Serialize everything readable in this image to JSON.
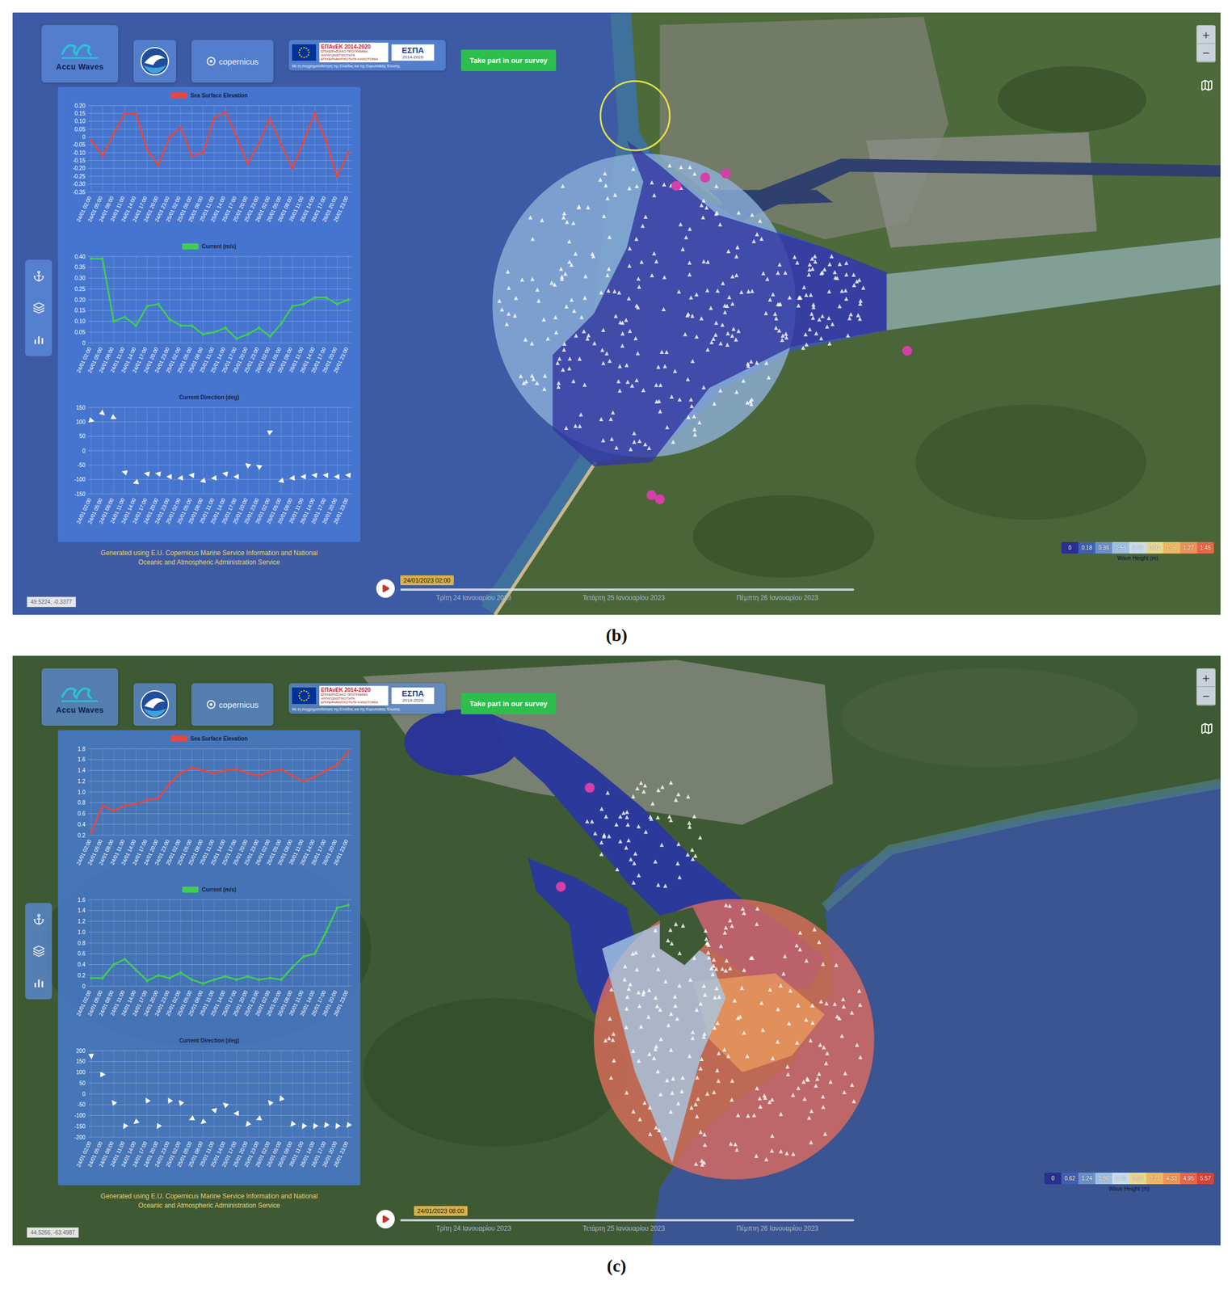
{
  "figures": [
    {
      "caption": "(b)",
      "kind": "estuary",
      "logos": {
        "app_name": "Accu Waves",
        "partner": "copernicus",
        "eu": {
          "epanek_title": "ΕΠΑνΕΚ 2014-2020",
          "epanek_subtitle": "ΕΠΙΧΕΙΡΗΣΙΑΚΟ ΠΡΟΓΡΑΜΜΑ ΑΝΤΑΓΩΝΙΣΤΙΚΟΤΗΤΑ ΕΠΙΧΕΙΡΗΜΑΤΙΚΟΤΗΤΑ ΚΑΙΝΟΤΟΜΙΑ",
          "espa_title": "ΕΣΠΑ",
          "espa_years": "2014-2020",
          "cofunding": "Με τη συγχρηματοδότηση της Ελλάδας και της Ευρωπαϊκής Ένωσης"
        }
      },
      "survey_button": "Take part in our survey",
      "zoom": [
        "+",
        "−"
      ],
      "charts": [
        {
          "title": "Sea Surface Elevation",
          "kind": "line",
          "color": "#e8473d",
          "y_ticks": [
            "0.20",
            "0.15",
            "0.10",
            "0.05",
            "0",
            "-0.05",
            "-0.10",
            "-0.15",
            "-0.20",
            "-0.25",
            "-0.30",
            "-0.35"
          ],
          "x_labels": [
            "24/01 02:00",
            "24/01 05:00",
            "24/01 08:00",
            "24/01 11:00",
            "24/01 14:00",
            "24/01 17:00",
            "24/01 20:00",
            "24/01 23:00",
            "25/01 02:00",
            "25/01 05:00",
            "25/01 08:00",
            "25/01 11:00",
            "25/01 14:00",
            "25/01 17:00",
            "25/01 20:00",
            "25/01 23:00",
            "26/01 02:00",
            "26/01 05:00",
            "26/01 08:00",
            "26/01 11:00",
            "26/01 14:00",
            "26/01 17:00",
            "26/01 20:00",
            "26/01 23:00"
          ],
          "values": [
            -0.02,
            -0.12,
            0.02,
            0.15,
            0.15,
            -0.08,
            -0.18,
            0.0,
            0.06,
            -0.12,
            -0.1,
            0.12,
            0.16,
            0.0,
            -0.17,
            -0.04,
            0.12,
            -0.05,
            -0.2,
            -0.03,
            0.15,
            -0.02,
            -0.25,
            -0.1
          ]
        },
        {
          "title": "Current (m/s)",
          "kind": "line",
          "color": "#3fcf4f",
          "y_ticks": [
            "0.40",
            "0.35",
            "0.30",
            "0.25",
            "0.20",
            "0.15",
            "0.10",
            "0.05",
            "0"
          ],
          "x_labels": [
            "24/01 02:00",
            "24/01 05:00",
            "24/01 08:00",
            "24/01 11:00",
            "24/01 14:00",
            "24/01 17:00",
            "24/01 20:00",
            "24/01 23:00",
            "25/01 02:00",
            "25/01 05:00",
            "25/01 08:00",
            "25/01 11:00",
            "25/01 14:00",
            "25/01 17:00",
            "25/01 20:00",
            "25/01 23:00",
            "26/01 02:00",
            "26/01 05:00",
            "26/01 08:00",
            "26/01 11:00",
            "26/01 14:00",
            "26/01 17:00",
            "26/01 20:00",
            "26/01 23:00"
          ],
          "values": [
            0.39,
            0.39,
            0.1,
            0.12,
            0.08,
            0.17,
            0.18,
            0.11,
            0.08,
            0.08,
            0.04,
            0.05,
            0.07,
            0.02,
            0.04,
            0.07,
            0.03,
            0.09,
            0.17,
            0.18,
            0.21,
            0.21,
            0.18,
            0.2
          ]
        },
        {
          "title": "Current Direction (deg)",
          "kind": "arrows",
          "color": "#ffffff",
          "y_ticks": [
            "150",
            "100",
            "50",
            "0",
            "-50",
            "-100",
            "-150"
          ],
          "x_labels": [
            "24/01 02:00",
            "24/01 05:00",
            "24/01 08:00",
            "24/01 11:00",
            "24/01 14:00",
            "24/01 17:00",
            "24/01 20:00",
            "24/01 23:00",
            "25/01 02:00",
            "25/01 05:00",
            "25/01 08:00",
            "25/01 11:00",
            "25/01 14:00",
            "25/01 17:00",
            "25/01 20:00",
            "25/01 23:00",
            "26/01 02:00",
            "26/01 05:00",
            "26/01 08:00",
            "26/01 11:00",
            "26/01 14:00",
            "26/01 17:00",
            "26/01 20:00",
            "26/01 23:00"
          ],
          "values": [
            105,
            130,
            115,
            -75,
            -110,
            -80,
            -80,
            -90,
            -95,
            -85,
            -105,
            -95,
            -80,
            -90,
            -50,
            -55,
            65,
            -105,
            -95,
            -90,
            -85,
            -85,
            -90,
            -85
          ]
        }
      ],
      "footnote": "Generated using E.U. Copernicus Marine Service Information and National Oceanic and Atmospheric Administration Service",
      "legend": {
        "title": "Wave Height (m)",
        "stops": [
          {
            "label": "0",
            "color": "#2b2f8f"
          },
          {
            "label": "0.18",
            "color": "#3f5fb0"
          },
          {
            "label": "0.36",
            "color": "#6b8fca"
          },
          {
            "label": "0.55",
            "color": "#9ec0e3"
          },
          {
            "label": "0.73",
            "color": "#c8dcea"
          },
          {
            "label": "0.91",
            "color": "#e8d890"
          },
          {
            "label": "1.09",
            "color": "#f0b860"
          },
          {
            "label": "1.27",
            "color": "#ee9455"
          },
          {
            "label": "1.45",
            "color": "#e8674a"
          }
        ]
      },
      "timeline": {
        "current": "24/01/2023 02:00",
        "level": 0.0,
        "days": [
          "Τρίτη 24 Ιανουαρίου 2023",
          "Τετάρτη 25 Ιανουαρίου 2023",
          "Πέμπτη 26 Ιανουαρίου 2023"
        ]
      },
      "coordinates": "49.5224, -0.3377"
    },
    {
      "caption": "(c)",
      "kind": "bay",
      "logos": {
        "app_name": "Accu Waves",
        "partner": "copernicus",
        "eu": {
          "epanek_title": "ΕΠΑνΕΚ 2014-2020",
          "epanek_subtitle": "ΕΠΙΧΕΙΡΗΣΙΑΚΟ ΠΡΟΓΡΑΜΜΑ ΑΝΤΑΓΩΝΙΣΤΙΚΟΤΗΤΑ ΕΠΙΧΕΙΡΗΜΑΤΙΚΟΤΗΤΑ ΚΑΙΝΟΤΟΜΙΑ",
          "espa_title": "ΕΣΠΑ",
          "espa_years": "2014-2020",
          "cofunding": "Με τη συγχρηματοδότηση της Ελλάδας και της Ευρωπαϊκής Ένωσης"
        }
      },
      "survey_button": "Take part in our survey",
      "zoom": [
        "+",
        "−"
      ],
      "charts": [
        {
          "title": "Sea Surface Elevation",
          "kind": "line",
          "color": "#e8473d",
          "y_ticks": [
            "1.8",
            "1.6",
            "1.4",
            "1.2",
            "1.0",
            "0.8",
            "0.6",
            "0.4",
            "0.2"
          ],
          "x_labels": [
            "24/01 02:00",
            "24/01 05:00",
            "24/01 08:00",
            "24/01 11:00",
            "24/01 14:00",
            "24/01 17:00",
            "24/01 20:00",
            "24/01 23:00",
            "25/01 02:00",
            "25/01 05:00",
            "25/01 08:00",
            "25/01 11:00",
            "25/01 14:00",
            "25/01 17:00",
            "25/01 20:00",
            "25/01 23:00",
            "26/01 02:00",
            "26/01 05:00",
            "26/01 08:00",
            "26/01 11:00",
            "26/01 14:00",
            "26/01 17:00",
            "26/01 20:00",
            "26/01 23:00"
          ],
          "values": [
            0.25,
            0.75,
            0.65,
            0.75,
            0.78,
            0.85,
            0.88,
            1.15,
            1.35,
            1.45,
            1.4,
            1.35,
            1.4,
            1.42,
            1.35,
            1.3,
            1.38,
            1.42,
            1.3,
            1.2,
            1.28,
            1.4,
            1.5,
            1.75
          ]
        },
        {
          "title": "Current (m/s)",
          "kind": "line",
          "color": "#3fcf4f",
          "y_ticks": [
            "1.6",
            "1.4",
            "1.2",
            "1.0",
            "0.8",
            "0.6",
            "0.4",
            "0.2",
            "0"
          ],
          "x_labels": [
            "24/01 02:00",
            "24/01 05:00",
            "24/01 08:00",
            "24/01 11:00",
            "24/01 14:00",
            "24/01 17:00",
            "24/01 20:00",
            "24/01 23:00",
            "25/01 02:00",
            "25/01 05:00",
            "25/01 08:00",
            "25/01 11:00",
            "25/01 14:00",
            "25/01 17:00",
            "25/01 20:00",
            "25/01 23:00",
            "26/01 02:00",
            "26/01 05:00",
            "26/01 08:00",
            "26/01 11:00",
            "26/01 14:00",
            "26/01 17:00",
            "26/01 20:00",
            "26/01 23:00"
          ],
          "values": [
            0.15,
            0.15,
            0.4,
            0.5,
            0.3,
            0.1,
            0.2,
            0.15,
            0.25,
            0.12,
            0.05,
            0.12,
            0.18,
            0.12,
            0.18,
            0.12,
            0.15,
            0.12,
            0.35,
            0.55,
            0.6,
            1.0,
            1.45,
            1.5
          ]
        },
        {
          "title": "Current Direction (deg)",
          "kind": "arrows",
          "color": "#ffffff",
          "y_ticks": [
            "200",
            "150",
            "100",
            "50",
            "0",
            "-50",
            "-100",
            "-150",
            "-200"
          ],
          "x_labels": [
            "24/01 02:00",
            "24/01 05:00",
            "24/01 08:00",
            "24/01 11:00",
            "24/01 14:00",
            "24/01 17:00",
            "24/01 20:00",
            "24/01 23:00",
            "25/01 02:00",
            "25/01 05:00",
            "25/01 08:00",
            "25/01 11:00",
            "25/01 14:00",
            "25/01 17:00",
            "25/01 20:00",
            "25/01 23:00",
            "26/01 02:00",
            "26/01 05:00",
            "26/01 08:00",
            "26/01 11:00",
            "26/01 14:00",
            "26/01 17:00",
            "26/01 20:00",
            "26/01 23:00"
          ],
          "values": [
            175,
            90,
            -40,
            -150,
            -130,
            -30,
            -150,
            -30,
            -40,
            -115,
            -130,
            -75,
            -50,
            -90,
            -140,
            -115,
            -40,
            -20,
            -140,
            -150,
            -150,
            -145,
            -150,
            -145
          ]
        }
      ],
      "footnote": "Generated using E.U. Copernicus Marine Service Information and National Oceanic and Atmospheric Administration Service",
      "legend": {
        "title": "Wave Height (m)",
        "stops": [
          {
            "label": "0",
            "color": "#2b2f8f"
          },
          {
            "label": "0.62",
            "color": "#3f5fb0"
          },
          {
            "label": "1.24",
            "color": "#6b8fca"
          },
          {
            "label": "1.86",
            "color": "#9ec0e3"
          },
          {
            "label": "2.48",
            "color": "#c8dcea"
          },
          {
            "label": "3.09",
            "color": "#e8d890"
          },
          {
            "label": "3.71",
            "color": "#f0b860"
          },
          {
            "label": "4.33",
            "color": "#ee9455"
          },
          {
            "label": "4.95",
            "color": "#e8674a"
          },
          {
            "label": "5.57",
            "color": "#d9433a"
          }
        ]
      },
      "timeline": {
        "current": "24/01/2023 08:00",
        "level": 0.03,
        "days": [
          "Τρίτη 24 Ιανουαρίου 2023",
          "Τετάρτη 25 Ιανουαρίου 2023",
          "Πέμπτη 26 Ιανουαρίου 2023"
        ]
      },
      "coordinates": "44.5266, -63.4987"
    }
  ]
}
